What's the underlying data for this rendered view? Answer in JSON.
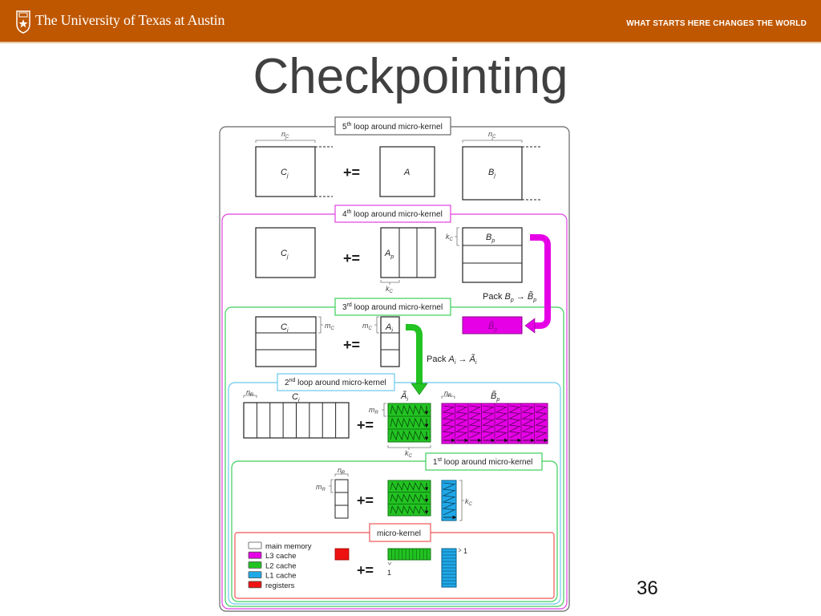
{
  "header": {
    "university": "The University of Texas at Austin",
    "tagline": "WHAT STARTS HERE CHANGES THE WORLD",
    "brand_color": "#bf5700"
  },
  "slide": {
    "title": "Checkpointing",
    "page_number": "36"
  },
  "diagram": {
    "colors": {
      "main_memory": "#ffffff",
      "l3": "#e600e6",
      "l2": "#22c322",
      "l1": "#1fa8e8",
      "registers": "#ee1111"
    },
    "loops": [
      {
        "id": "loop5",
        "sup": "th",
        "num": "5",
        "label": " loop around micro-kernel",
        "color": "#666666"
      },
      {
        "id": "loop4",
        "sup": "th",
        "num": "4",
        "label": " loop around micro-kernel",
        "color": "#e040e0"
      },
      {
        "id": "loop3",
        "sup": "rd",
        "num": "3",
        "label": " loop around micro-kernel",
        "color": "#3ccf5a"
      },
      {
        "id": "loop2",
        "sup": "nd",
        "num": "2",
        "label": " loop around micro-kernel",
        "color": "#6ac8ee"
      },
      {
        "id": "loop1",
        "sup": "st",
        "num": "1",
        "label": " loop around micro-kernel",
        "color": "#3ccf5a"
      },
      {
        "id": "micro",
        "sup": "",
        "num": "",
        "label": "micro-kernel",
        "color": "#ee5555"
      }
    ],
    "op": "+=",
    "labels": {
      "Cj": "C",
      "Cj_sub": "j",
      "A": "A",
      "Bj": "B",
      "Bj_sub": "j",
      "Ap": "A",
      "Ap_sub": "p",
      "Bp": "B",
      "Bp_sub": "p",
      "Ci": "C",
      "Ci_sub": "i",
      "Ai": "A",
      "Ai_sub": "i",
      "Btilde": "B̃",
      "Btilde_sub": "p",
      "Atilde": "Ã",
      "Atilde_sub": "i",
      "nC": "n",
      "nC_sub": "C",
      "kC": "k",
      "kC_sub": "C",
      "mC": "m",
      "mC_sub": "C",
      "nR": "n",
      "nR_sub": "R",
      "mR": "m",
      "mR_sub": "R",
      "one": "1"
    },
    "pack_B": {
      "prefix": "Pack ",
      "from": "B",
      "from_sub": "p",
      "arrow": " → ",
      "to": "B̃",
      "to_sub": "p"
    },
    "pack_A": {
      "prefix": "Pack ",
      "from": "A",
      "from_sub": "i",
      "arrow": " → ",
      "to": "Ã",
      "to_sub": "i"
    },
    "legend": [
      {
        "label": "main memory",
        "color": "#ffffff"
      },
      {
        "label": "L3 cache",
        "color": "#e600e6"
      },
      {
        "label": "L2 cache",
        "color": "#22c322"
      },
      {
        "label": "L1 cache",
        "color": "#1fa8e8"
      },
      {
        "label": "registers",
        "color": "#ee1111"
      }
    ]
  }
}
